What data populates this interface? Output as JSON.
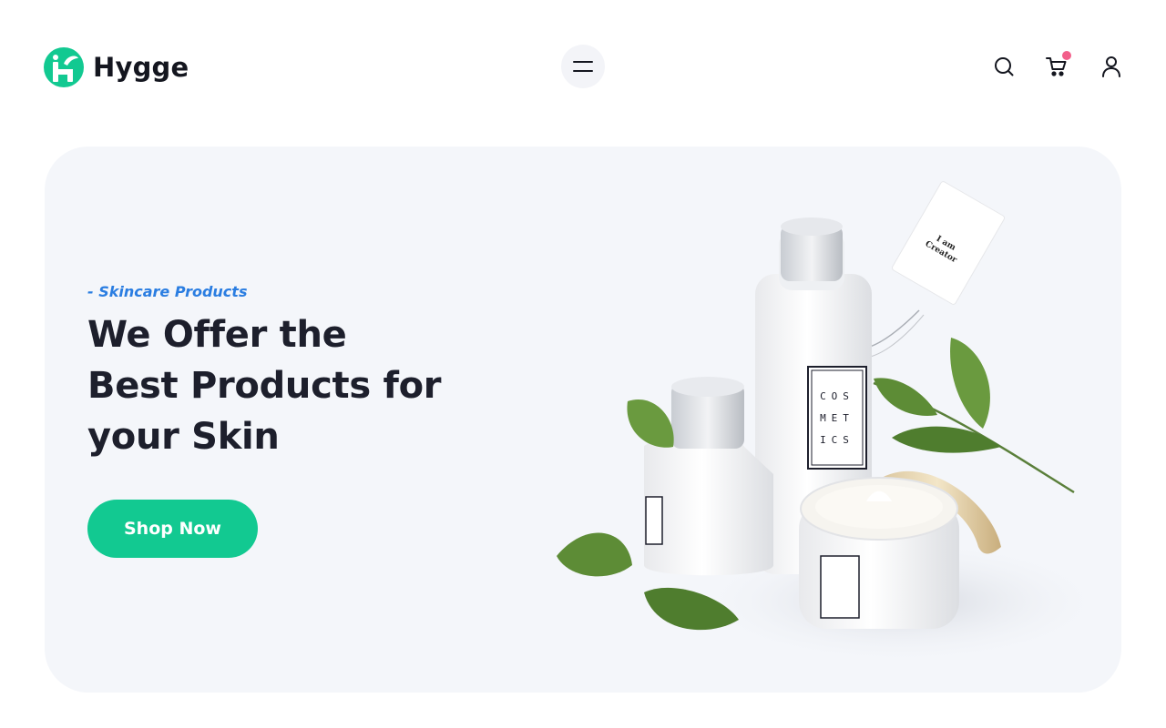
{
  "brand": {
    "name": "Hygge",
    "logo_color": "#12c991"
  },
  "header": {
    "menu_icon": "hamburger-icon",
    "actions": [
      {
        "name": "search",
        "icon": "search-icon"
      },
      {
        "name": "cart",
        "icon": "cart-icon",
        "has_notification_dot": true,
        "dot_color": "#f25f8a"
      },
      {
        "name": "account",
        "icon": "user-icon"
      }
    ]
  },
  "hero": {
    "eyebrow": "- Skincare Products",
    "headline_lines": [
      "We Offer the",
      "Best Products for",
      "your Skin"
    ],
    "cta_label": "Shop Now",
    "accent_color": "#12c991",
    "eyebrow_color": "#2a7de1",
    "background_color": "#f4f6fa",
    "image": {
      "bottle_label": [
        "COS",
        "MET",
        "ICS"
      ],
      "tag_text": [
        "I am",
        "Creator"
      ]
    }
  }
}
